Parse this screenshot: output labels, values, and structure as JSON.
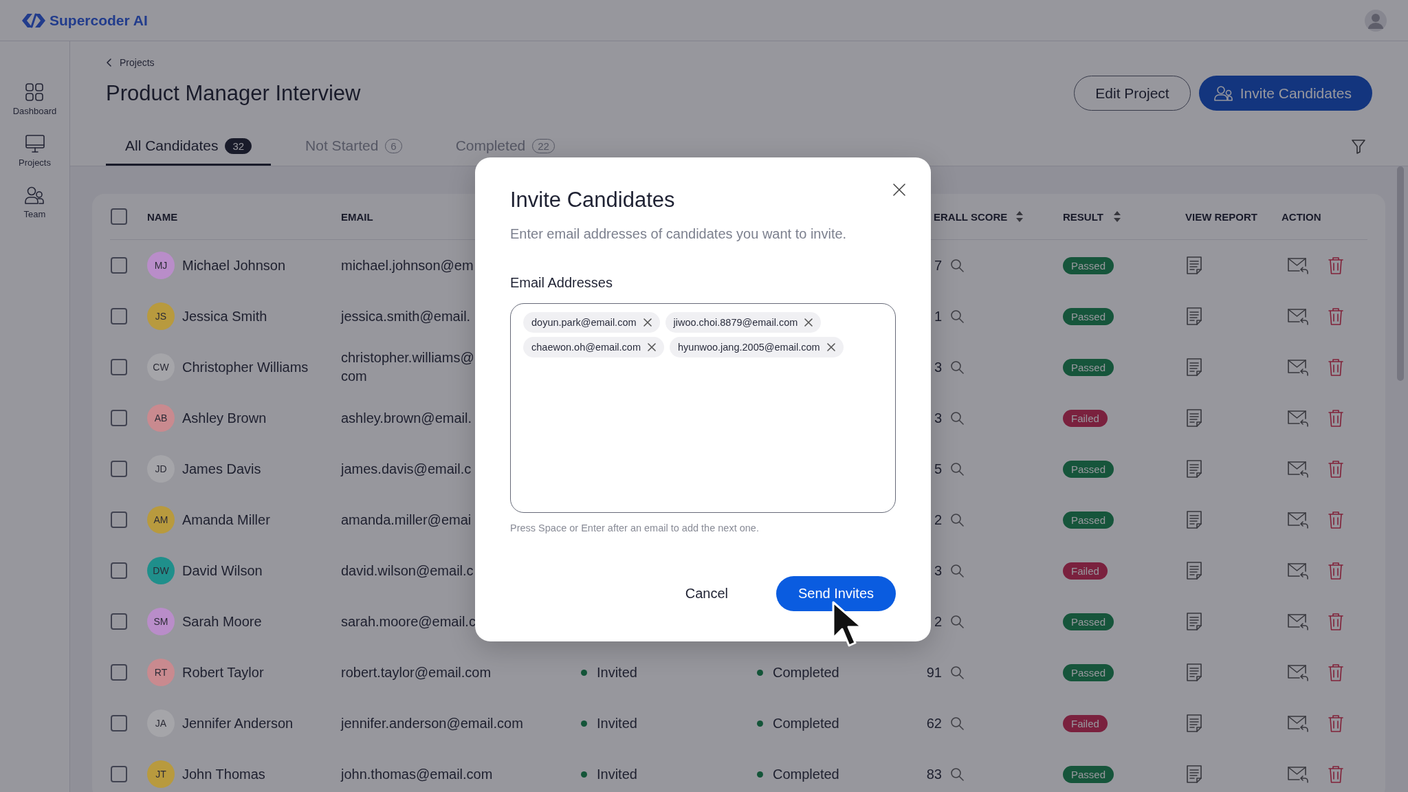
{
  "app": {
    "logo_text": "Supercoder AI"
  },
  "sidebar": {
    "items": [
      {
        "label": "Dashboard",
        "kind": "dashboard"
      },
      {
        "label": "Projects",
        "kind": "projects"
      },
      {
        "label": "Team",
        "kind": "team"
      }
    ]
  },
  "breadcrumb": {
    "label": "Projects"
  },
  "page_title": "Product Manager Interview",
  "header_buttons": [
    {
      "label": "Edit Project",
      "kind": "outline"
    },
    {
      "label": "Invite Candidates",
      "kind": "primary"
    }
  ],
  "tabs": [
    {
      "label": "All Candidates",
      "count": "32",
      "selected": true
    },
    {
      "label": "Not Started",
      "count": "6",
      "selected": false
    },
    {
      "label": "Completed",
      "count": "22",
      "selected": false
    }
  ],
  "table": {
    "select_all": {
      "checked": false
    },
    "columns": [
      {
        "label": "NAME",
        "kind": "name",
        "sortable": false
      },
      {
        "label": "EMAIL",
        "kind": "email",
        "sortable": false
      },
      {
        "label": "ERALL SCORE",
        "kind": "score",
        "sortable": true
      },
      {
        "label": "RESULT",
        "kind": "result",
        "sortable": true
      },
      {
        "label": "VIEW REPORT",
        "kind": "report",
        "sortable": false
      },
      {
        "label": "ACTION",
        "kind": "action",
        "sortable": false
      }
    ],
    "rows": [
      {
        "checked": false,
        "initials": "MJ",
        "color": "#b98dc9",
        "name": "Michael Johnson",
        "email": "michael.johnson@em",
        "score": "7",
        "result": {
          "label": "Passed",
          "kind": "pass"
        }
      },
      {
        "checked": false,
        "initials": "JS",
        "color": "#b89a3e",
        "name": "Jessica Smith",
        "email": "jessica.smith@email.",
        "score": "1",
        "result": {
          "label": "Passed",
          "kind": "pass"
        }
      },
      {
        "checked": false,
        "initials": "CW",
        "color": "#a5a5a9",
        "name": "Christopher Williams",
        "email": "christopher.williams@\ncom",
        "score": "3",
        "result": {
          "label": "Passed",
          "kind": "pass"
        }
      },
      {
        "checked": false,
        "initials": "AB",
        "color": "#c98a8f",
        "name": "Ashley Brown",
        "email": "ashley.brown@email.",
        "score": "3",
        "result": {
          "label": "Failed",
          "kind": "fail"
        }
      },
      {
        "checked": false,
        "initials": "JD",
        "color": "#a5a5a9",
        "name": "James Davis",
        "email": "james.davis@email.c",
        "score": "5",
        "result": {
          "label": "Passed",
          "kind": "pass"
        }
      },
      {
        "checked": false,
        "initials": "AM",
        "color": "#b89a3e",
        "name": "Amanda Miller",
        "email": "amanda.miller@emai",
        "score": "2",
        "result": {
          "label": "Passed",
          "kind": "pass"
        }
      },
      {
        "checked": false,
        "initials": "DW",
        "color": "#1f8f8b",
        "name": "David Wilson",
        "email": "david.wilson@email.c",
        "score": "3",
        "result": {
          "label": "Failed",
          "kind": "fail"
        }
      },
      {
        "checked": false,
        "initials": "SM",
        "color": "#b98dc9",
        "name": "Sarah Moore",
        "email": "sarah.moore@email.c",
        "score": "2",
        "result": {
          "label": "Passed",
          "kind": "pass"
        }
      },
      {
        "checked": false,
        "initials": "RT",
        "color": "#c98a8f",
        "name": "Robert Taylor",
        "email": "robert.taylor@email.com",
        "invite_status": "Invited",
        "test_status": "Completed",
        "score": "91",
        "result": {
          "label": "Passed",
          "kind": "pass"
        }
      },
      {
        "checked": false,
        "initials": "JA",
        "color": "#a5a5a9",
        "name": "Jennifer Anderson",
        "email": "jennifer.anderson@email.com",
        "invite_status": "Invited",
        "test_status": "Completed",
        "score": "62",
        "result": {
          "label": "Failed",
          "kind": "fail"
        }
      },
      {
        "checked": false,
        "initials": "JT",
        "color": "#b89a3e",
        "name": "John Thomas",
        "email": "john.thomas@email.com",
        "invite_status": "Invited",
        "test_status": "Completed",
        "score": "83",
        "result": {
          "label": "Passed",
          "kind": "pass"
        }
      }
    ]
  },
  "modal": {
    "title": "Invite Candidates",
    "subtitle": "Enter email addresses of candidates you want to invite.",
    "field_label": "Email Addresses",
    "chips": [
      "doyun.park@email.com",
      "jiwoo.choi.8879@email.com",
      "chaewon.oh@email.com",
      "hyunwoo.jang.2005@email.com"
    ],
    "hint": "Press Space or Enter after an email to add the next one.",
    "buttons": [
      {
        "label": "Cancel",
        "kind": "text"
      },
      {
        "label": "Send Invites",
        "kind": "primary"
      }
    ]
  }
}
